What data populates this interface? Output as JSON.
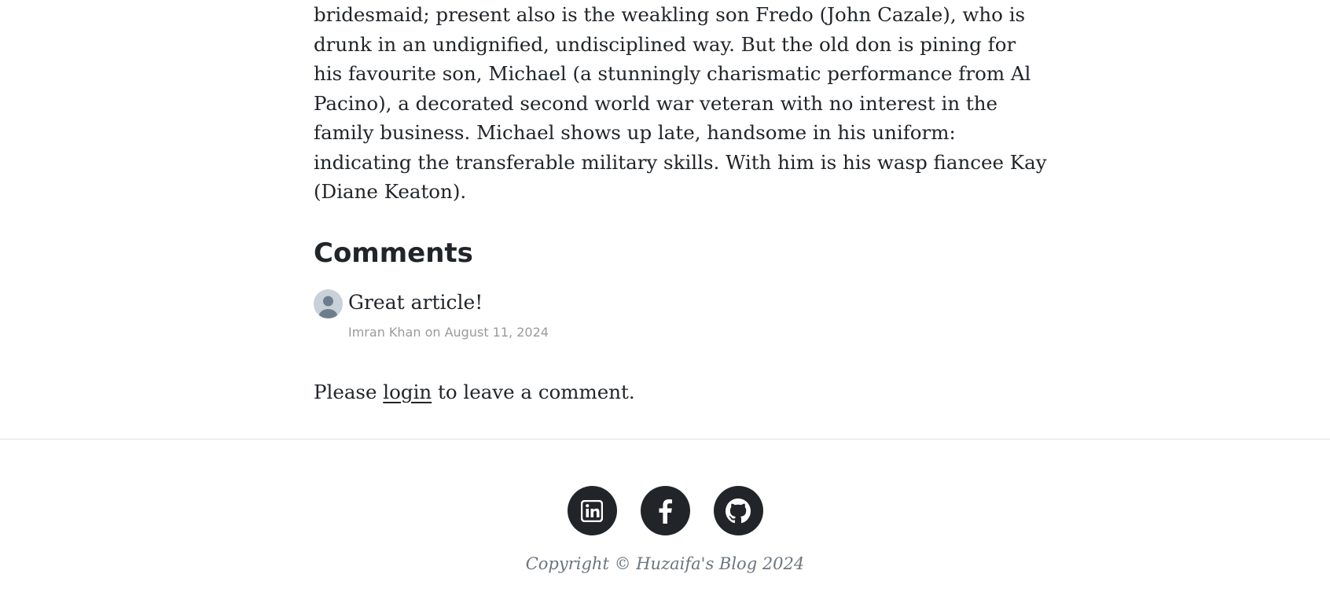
{
  "article": {
    "lines": [
      "bridesmaid; present also is the weakling son Fredo (John Cazale), who is",
      "drunk in an undignified, undisciplined way. But the old don is pining for",
      "his favourite son, Michael (a stunningly charismatic performance from Al",
      "Pacino), a decorated second world war veteran with no interest in the",
      "family business. Michael shows up late, handsome in his uniform:",
      "indicating the transferable military skills. With him is his wasp fiancee Kay",
      "(Diane Keaton)."
    ]
  },
  "comments": {
    "heading": "Comments",
    "items": [
      {
        "text": "Great article!",
        "meta": "Imran Khan on August 11, 2024",
        "avatar_icon": "user-avatar-icon"
      }
    ],
    "prompt_before": "Please ",
    "prompt_link": "login",
    "prompt_after": " to leave a comment."
  },
  "footer": {
    "socials": [
      {
        "name": "linkedin",
        "icon": "linkedin-icon"
      },
      {
        "name": "facebook",
        "icon": "facebook-icon"
      },
      {
        "name": "github",
        "icon": "github-icon"
      }
    ],
    "copyright": "Copyright © Huzaifa's Blog 2024"
  },
  "colors": {
    "text": "#212529",
    "muted": "#6c757d",
    "meta": "#9a9a9a",
    "social_bg": "#212529",
    "divider": "#dee2e6"
  }
}
